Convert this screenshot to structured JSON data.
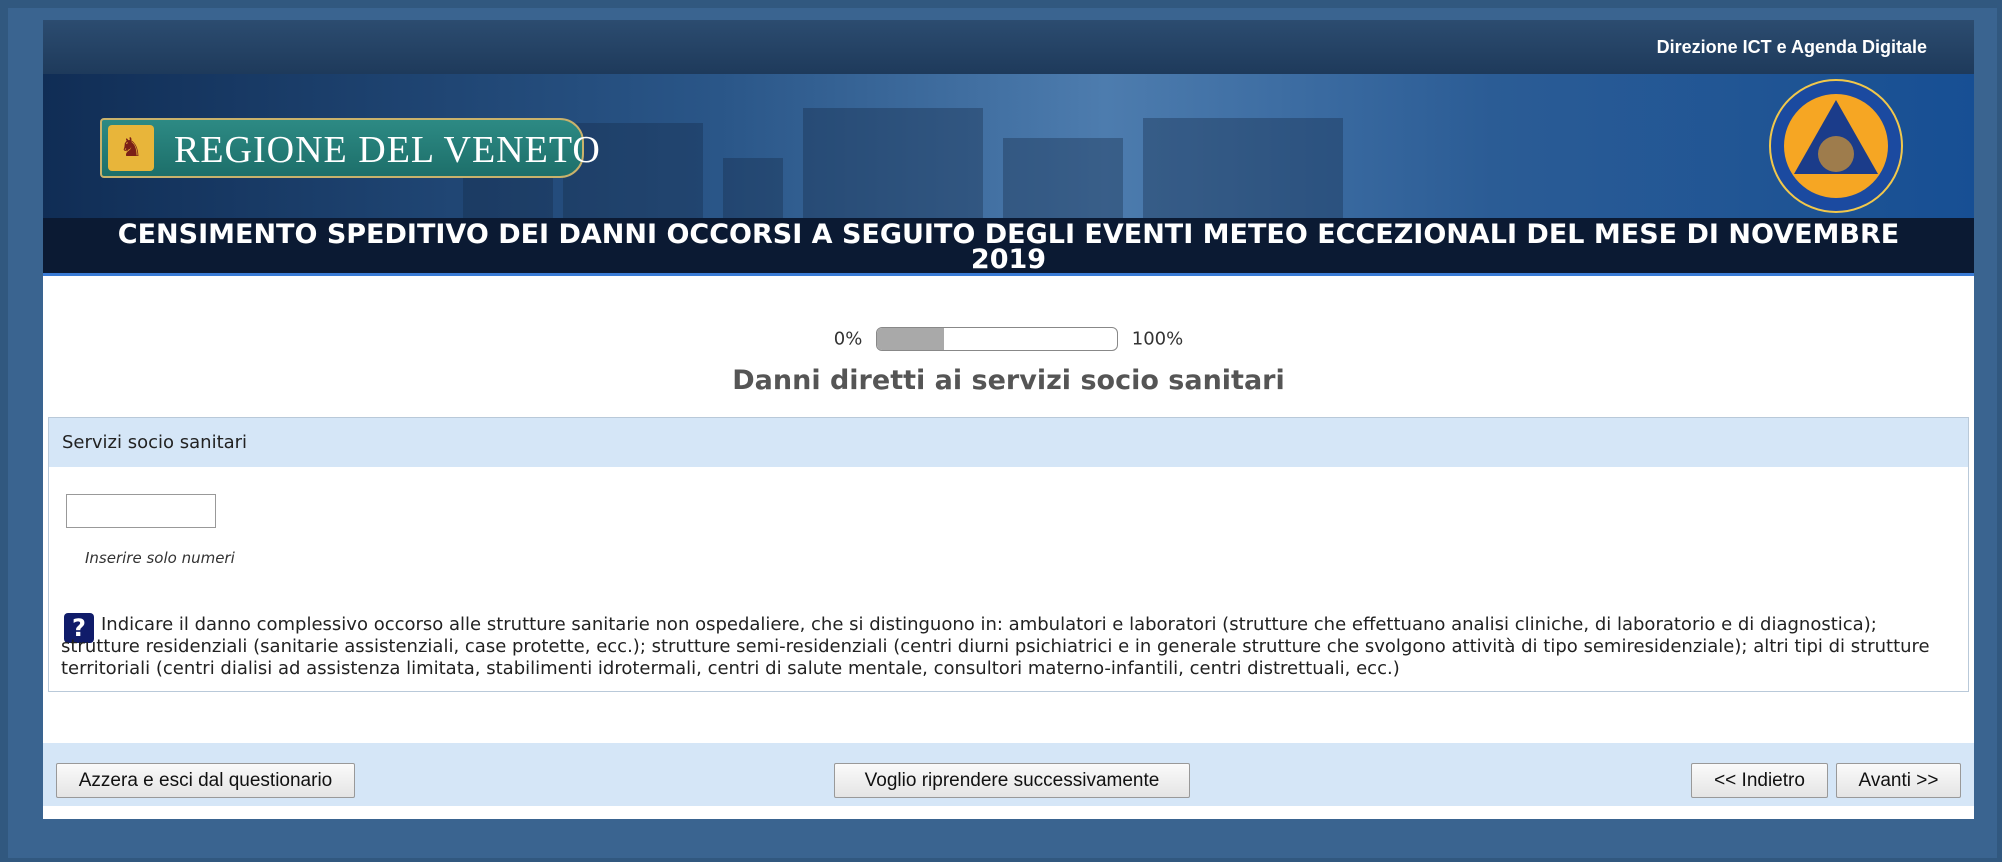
{
  "header": {
    "agency": "Direzione ICT e Agenda Digitale",
    "logo_text": "REGIONE DEL VENETO",
    "logo_emblem": "lion-of-saint-mark-emblem",
    "protezione_civile_logo": "protezione-civile-logo",
    "title": "CENSIMENTO SPEDITIVO DEI DANNI OCCORSI A SEGUITO DEGLI EVENTI METEO ECCEZIONALI DEL MESE DI NOVEMBRE 2019"
  },
  "progress": {
    "start_label": "0%",
    "end_label": "100%",
    "fraction": 0.28
  },
  "page": {
    "heading": "Danni diretti ai servizi socio sanitari"
  },
  "question": {
    "label": "Servizi socio sanitari",
    "value": "",
    "hint": "Inserire solo numeri",
    "help_icon": "question-mark-icon",
    "help_text": "Indicare il danno complessivo occorso alle strutture sanitarie non ospedaliere, che si distinguono in: ambulatori e laboratori (strutture che effettuano analisi cliniche, di laboratorio e di diagnostica); strutture residenziali (sanitarie assistenziali, case protette, ecc.); strutture semi-residenziali (centri diurni psichiatrici e in generale strutture che svolgono attività di tipo semiresidenziale); altri tipi di strutture territoriali (centri dialisi ad assistenza limitata, stabilimenti idrotermali, centri di salute mentale, consultori materno-infantili, centri distrettuali, ecc.)"
  },
  "footer": {
    "reset_label": "Azzera e esci dal questionario",
    "resume_later_label": "Voglio riprendere successivamente",
    "back_label": "<< Indietro",
    "next_label": "Avanti >>"
  },
  "colors": {
    "page_background": "#31587f",
    "header_dark": "#0b1a33",
    "panel_header": "#d5e6f7",
    "help_icon": "#101c6a"
  }
}
